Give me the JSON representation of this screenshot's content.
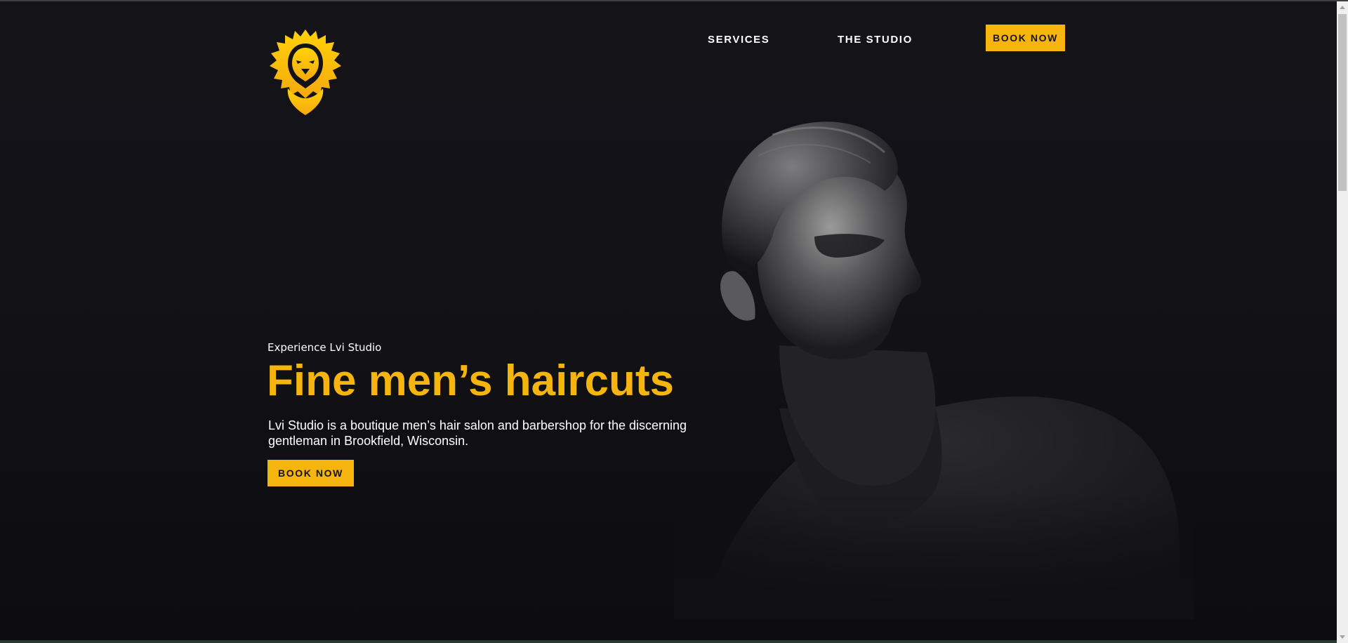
{
  "header": {
    "logo_icon": "lion-head-icon",
    "nav": [
      {
        "label": "SERVICES"
      },
      {
        "label": "THE STUDIO"
      }
    ],
    "book_label": "BOOK NOW"
  },
  "hero": {
    "eyebrow": "Experience Lvi Studio",
    "headline": "Fine men’s haircuts",
    "description": "Lvi Studio is a boutique men’s hair salon and barbershop for the discerning gentleman in Brookfield, Wisconsin.",
    "cta_label": "BOOK NOW",
    "image": "bearded-man-portrait"
  },
  "colors": {
    "accent": "#f6b40e",
    "background": "#121217",
    "text": "#ffffff"
  }
}
